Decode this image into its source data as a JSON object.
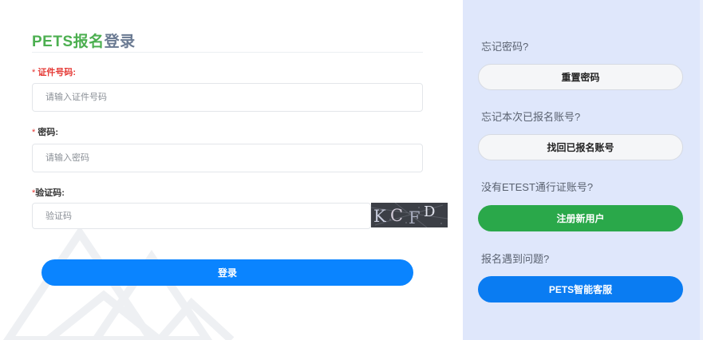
{
  "form": {
    "title_part1": "PETS报名",
    "title_part2": "登录",
    "id_label": "证件号码:",
    "id_placeholder": "请输入证件号码",
    "password_label": "密码:",
    "password_placeholder": "请输入密码",
    "captcha_label": "验证码:",
    "captcha_placeholder": "验证码",
    "captcha_chars": [
      "K",
      "C",
      "F",
      "D"
    ],
    "required_mark": "*",
    "login_button": "登录"
  },
  "side": {
    "forgot_password_text": "忘记密码?",
    "reset_password_button": "重置密码",
    "forgot_account_text": "忘记本次已报名账号?",
    "recover_account_button": "找回已报名账号",
    "no_account_text": "没有ETEST通行证账号?",
    "register_button": "注册新用户",
    "help_text": "报名遇到问题?",
    "service_button": "PETS智能客服"
  },
  "colors": {
    "accent_blue": "#0a84ff",
    "green": "#2aa84a",
    "title_green": "#4caf50",
    "required_red": "#e53935",
    "side_bg": "#dfe7fb"
  }
}
